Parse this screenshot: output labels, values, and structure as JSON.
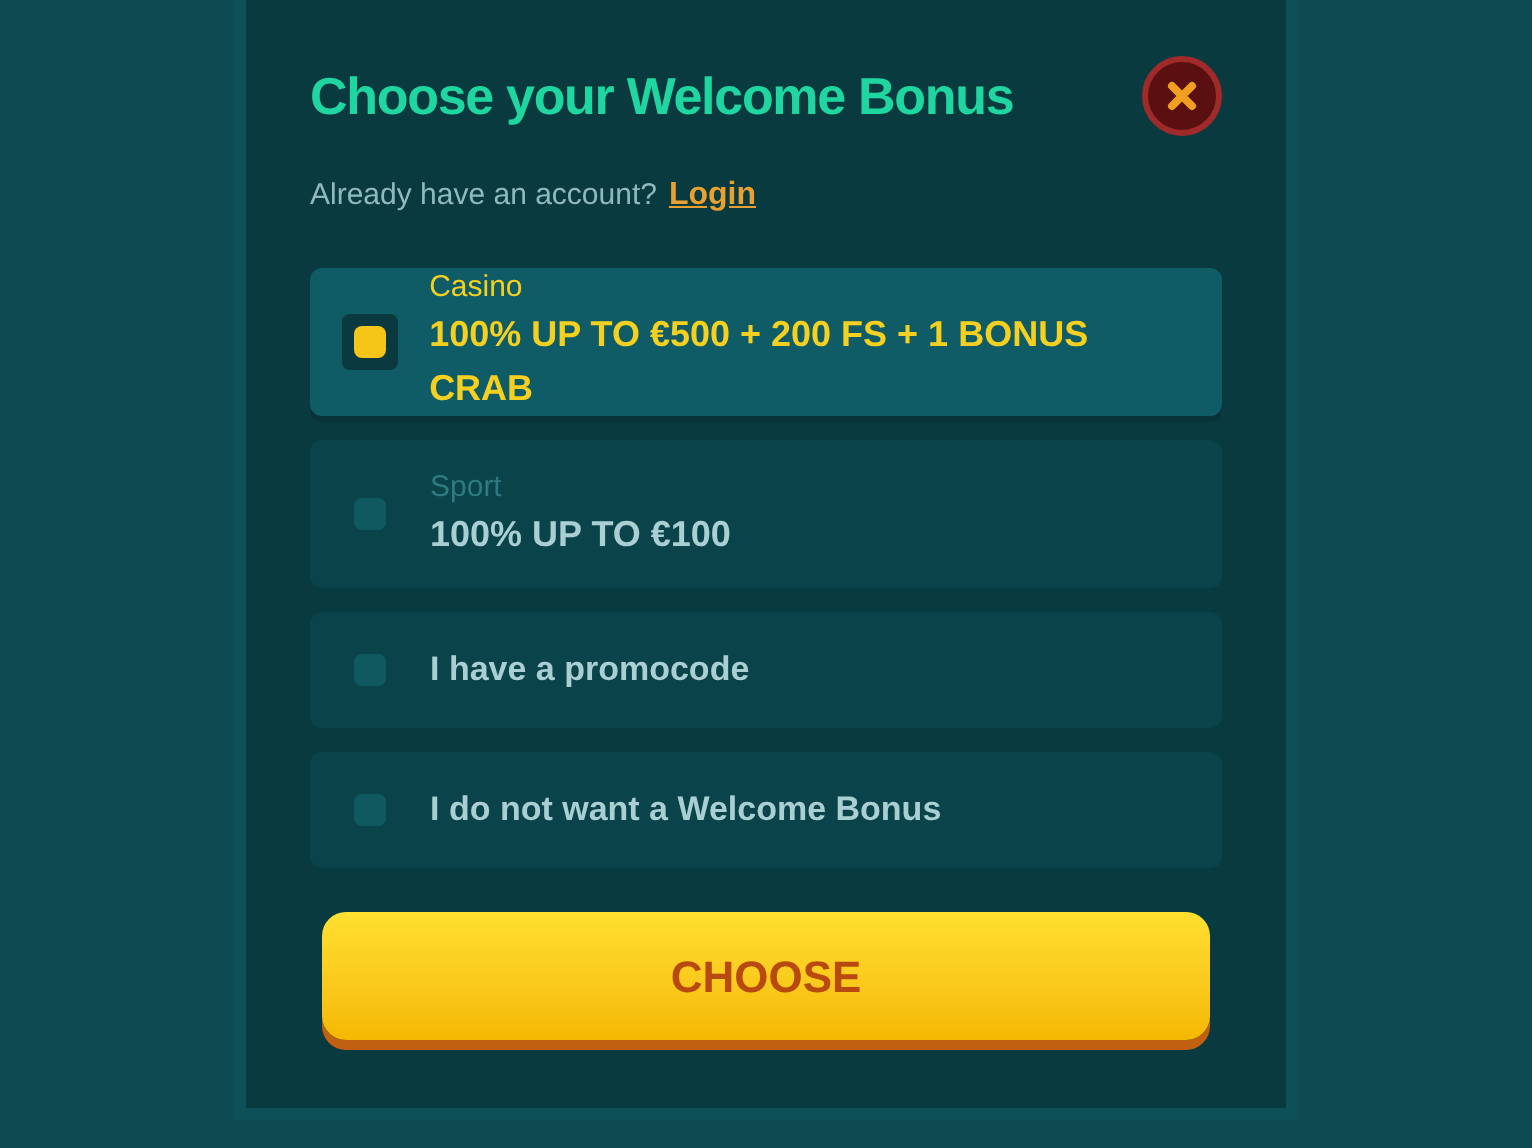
{
  "dialog": {
    "title": "Choose your Welcome Bonus",
    "login_prompt": "Already have an account?",
    "login_link": "Login"
  },
  "options": [
    {
      "kind": "offer",
      "label": "Casino",
      "value": "100% UP TO €500 + 200 FS + 1 BONUS CRAB",
      "selected": true
    },
    {
      "kind": "offer",
      "label": "Sport",
      "value": "100% UP TO €100",
      "selected": false
    },
    {
      "kind": "simple",
      "value": "I have a promocode",
      "selected": false
    },
    {
      "kind": "simple",
      "value": "I do not want a Welcome Bonus",
      "selected": false
    }
  ],
  "button": "CHOOSE"
}
